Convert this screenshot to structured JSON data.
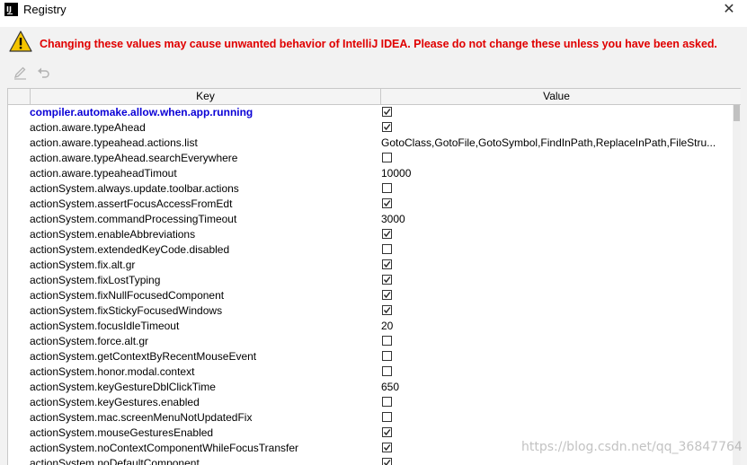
{
  "window": {
    "app_icon_text": "IJ",
    "title": "Registry",
    "close_glyph": "✕"
  },
  "warning": {
    "icon": "warning-triangle-icon",
    "text": "Changing these values may cause unwanted behavior of IntelliJ IDEA. Please do not change these unless you have been asked."
  },
  "toolbar": {
    "edit_icon": "pencil-icon",
    "revert_icon": "undo-icon"
  },
  "table": {
    "columns": [
      "Key",
      "Value"
    ],
    "rows": [
      {
        "key": "compiler.automake.allow.when.app.running",
        "type": "bool",
        "checked": true,
        "changed": true
      },
      {
        "key": "action.aware.typeAhead",
        "type": "bool",
        "checked": true
      },
      {
        "key": "action.aware.typeahead.actions.list",
        "type": "text",
        "value": "GotoClass,GotoFile,GotoSymbol,FindInPath,ReplaceInPath,FileStru..."
      },
      {
        "key": "action.aware.typeAhead.searchEverywhere",
        "type": "bool",
        "checked": false
      },
      {
        "key": "action.aware.typeaheadTimout",
        "type": "text",
        "value": "10000"
      },
      {
        "key": "actionSystem.always.update.toolbar.actions",
        "type": "bool",
        "checked": false
      },
      {
        "key": "actionSystem.assertFocusAccessFromEdt",
        "type": "bool",
        "checked": true
      },
      {
        "key": "actionSystem.commandProcessingTimeout",
        "type": "text",
        "value": "3000"
      },
      {
        "key": "actionSystem.enableAbbreviations",
        "type": "bool",
        "checked": true
      },
      {
        "key": "actionSystem.extendedKeyCode.disabled",
        "type": "bool",
        "checked": false
      },
      {
        "key": "actionSystem.fix.alt.gr",
        "type": "bool",
        "checked": true
      },
      {
        "key": "actionSystem.fixLostTyping",
        "type": "bool",
        "checked": true
      },
      {
        "key": "actionSystem.fixNullFocusedComponent",
        "type": "bool",
        "checked": true
      },
      {
        "key": "actionSystem.fixStickyFocusedWindows",
        "type": "bool",
        "checked": true
      },
      {
        "key": "actionSystem.focusIdleTimeout",
        "type": "text",
        "value": "20"
      },
      {
        "key": "actionSystem.force.alt.gr",
        "type": "bool",
        "checked": false
      },
      {
        "key": "actionSystem.getContextByRecentMouseEvent",
        "type": "bool",
        "checked": false
      },
      {
        "key": "actionSystem.honor.modal.context",
        "type": "bool",
        "checked": false
      },
      {
        "key": "actionSystem.keyGestureDblClickTime",
        "type": "text",
        "value": "650"
      },
      {
        "key": "actionSystem.keyGestures.enabled",
        "type": "bool",
        "checked": false
      },
      {
        "key": "actionSystem.mac.screenMenuNotUpdatedFix",
        "type": "bool",
        "checked": false
      },
      {
        "key": "actionSystem.mouseGesturesEnabled",
        "type": "bool",
        "checked": true
      },
      {
        "key": "actionSystem.noContextComponentWhileFocusTransfer",
        "type": "bool",
        "checked": true
      },
      {
        "key": "actionSystem.noDefaultComponent",
        "type": "bool",
        "checked": true
      }
    ]
  },
  "watermark": {
    "text": "https://blog.csdn.net/qq_36847764"
  },
  "colors": {
    "warning_text": "#e00000",
    "changed_key": "#0a00d6"
  }
}
